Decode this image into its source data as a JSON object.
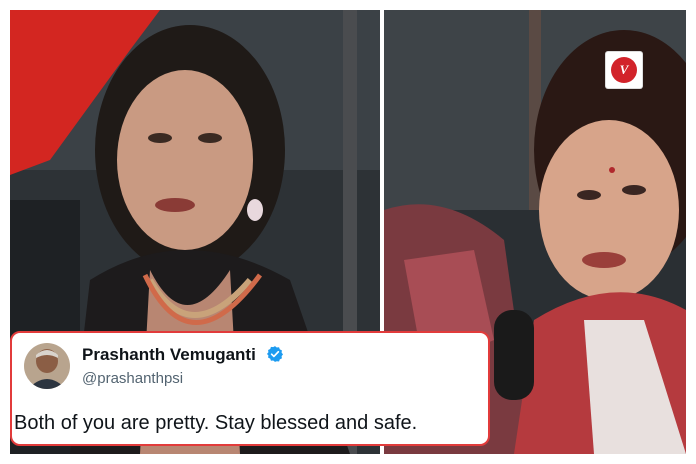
{
  "tweet": {
    "author_name": "Prashanth Vemuganti",
    "author_handle": "@prashanthpsi",
    "text": "Both of you are pretty. Stay blessed and safe.",
    "verified_icon": "verified-badge-icon",
    "border_color": "#e23b3b"
  },
  "logo": {
    "glyph": "V"
  },
  "colors": {
    "verified": "#1d9bf0",
    "name": "#0f1419",
    "handle": "#536471"
  }
}
